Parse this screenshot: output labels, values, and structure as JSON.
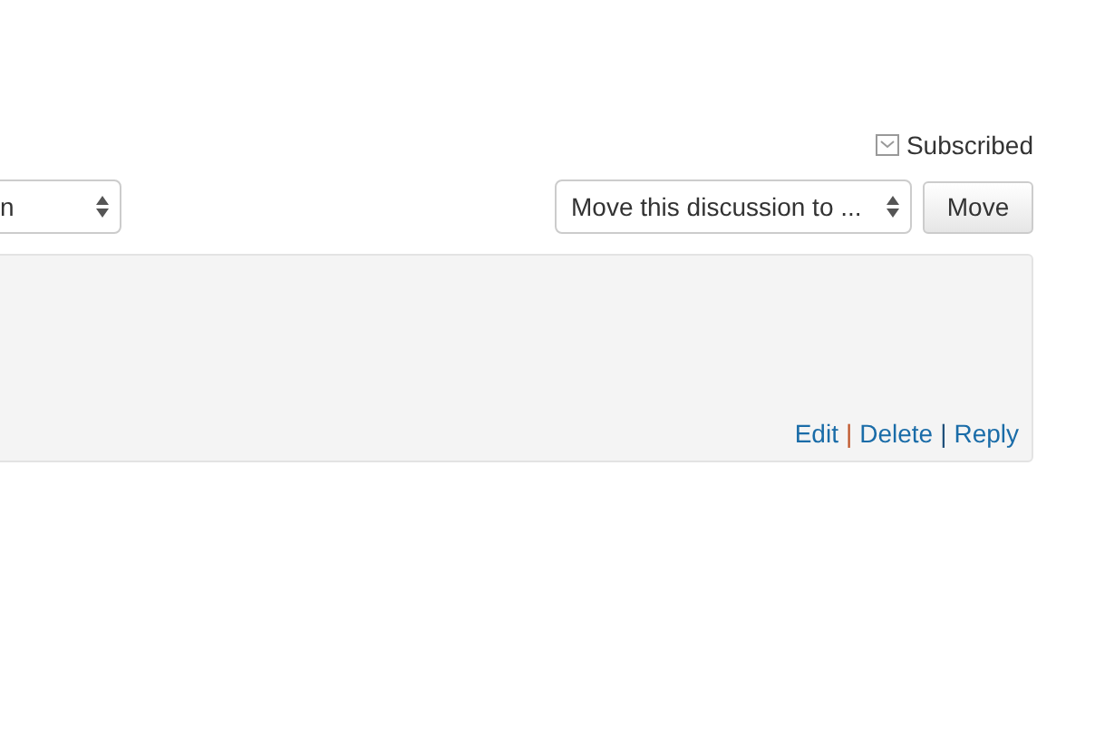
{
  "subscription": {
    "label": "Subscribed"
  },
  "forum_select": {
    "value": "n"
  },
  "move_select": {
    "value": "Move this discussion to ..."
  },
  "move_button": {
    "label": "Move"
  },
  "post_actions": [
    {
      "kind": "link",
      "text": "Edit"
    },
    {
      "kind": "separator",
      "text": "|",
      "color": "#c0572b"
    },
    {
      "kind": "link",
      "text": "Delete"
    },
    {
      "kind": "separator",
      "text": "|",
      "color": "#1f4f7a"
    },
    {
      "kind": "link",
      "text": "Reply"
    }
  ]
}
